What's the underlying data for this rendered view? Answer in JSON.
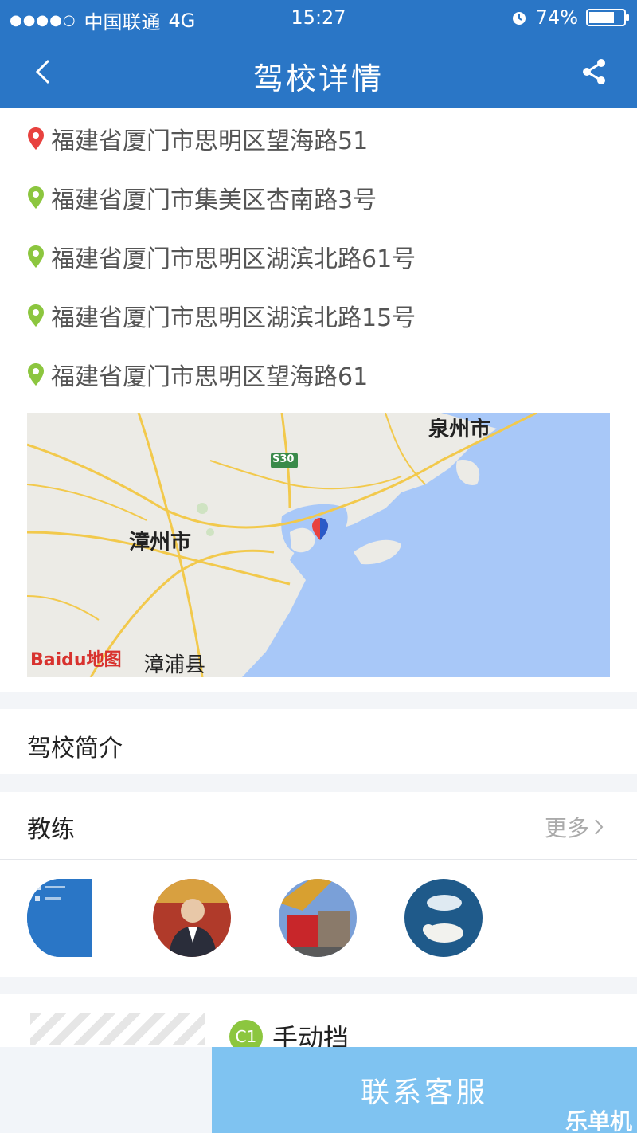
{
  "status_bar": {
    "signal_dots": "●●●●○",
    "carrier": "中国联通",
    "network": "4G",
    "time": "15:27",
    "battery_text": "74%",
    "battery_level": 0.74
  },
  "nav": {
    "title": "驾校详情",
    "back_icon": "chevron-left-icon",
    "share_icon": "share-icon"
  },
  "addresses": [
    {
      "text": "福建省厦门市思明区望海路51",
      "pin_color": "#e8423f"
    },
    {
      "text": "福建省厦门市集美区杏南路3号",
      "pin_color": "#8cc63f"
    },
    {
      "text": "福建省厦门市思明区湖滨北路61号",
      "pin_color": "#8cc63f"
    },
    {
      "text": "福建省厦门市思明区湖滨北路15号",
      "pin_color": "#8cc63f"
    },
    {
      "text": "福建省厦门市思明区望海路61",
      "pin_color": "#8cc63f"
    }
  ],
  "map": {
    "labels": {
      "quanzhou": "泉州市",
      "zhangzhou": "漳州市",
      "zhangpu": "漳浦县",
      "road": "S30"
    },
    "logo_text": "Baidu地图",
    "sea_color": "#a8c8f8"
  },
  "intro": {
    "label": "驾校简介"
  },
  "coach": {
    "label": "教练",
    "more": "更多"
  },
  "package": {
    "badge": "C1",
    "title": "手动挡"
  },
  "contact": {
    "label": "联系客服"
  },
  "watermark": "乐单机"
}
